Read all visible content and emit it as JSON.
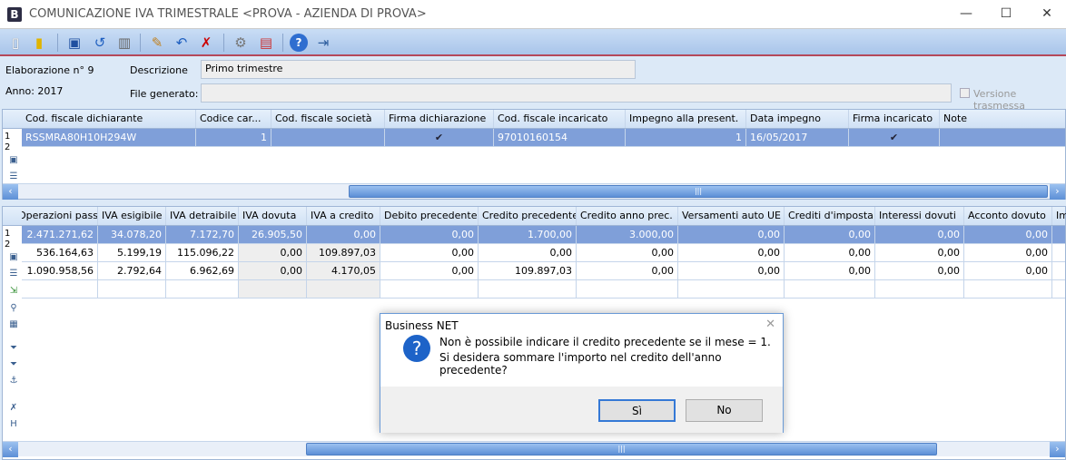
{
  "window": {
    "logo": "B",
    "title": "COMUNICAZIONE IVA TRIMESTRALE <PROVA - AZIENDA DI PROVA>",
    "minimize": "—",
    "maximize": "☐",
    "close": "✕"
  },
  "toolbar": [
    "new-icon",
    "open-icon",
    "save-icon",
    "undo-icon",
    "delete-icon",
    "edit-icon",
    "edit-undo-icon",
    "edit-cancel-icon",
    "settings-icon",
    "pdf-icon",
    "help-icon",
    "exit-icon"
  ],
  "header": {
    "elaborazione": "Elaborazione n° 9",
    "anno": "Anno: 2017",
    "descrizione_label": "Descrizione",
    "descrizione_value": "Primo trimestre",
    "file_label": "File generato:",
    "file_value": "",
    "versione_label": "Versione trasmessa"
  },
  "top_grid": {
    "columns": [
      "Cod. fiscale dichiarante",
      "Codice car...",
      "Cod. fiscale società",
      "Firma dichiarazione",
      "Cod. fiscale incaricato",
      "Impegno alla present.",
      "Data impegno",
      "Firma incaricato",
      "Note"
    ],
    "row_numbers": [
      "1",
      "2"
    ],
    "rows": [
      [
        "RSSMRA80H10H294W",
        "1",
        "",
        "✔",
        "97010160154",
        "1",
        "16/05/2017",
        "✔",
        ""
      ]
    ]
  },
  "bottom_grid": {
    "columns": [
      "Operazioni pass.",
      "IVA esigibile",
      "IVA detraibile",
      "IVA dovuta",
      "IVA a credito",
      "Debito precedente",
      "Credito precedente",
      "Credito anno prec.",
      "Versamenti auto UE",
      "Crediti d'imposta",
      "Interessi dovuti",
      "Acconto dovuto",
      "Im"
    ],
    "row_numbers": [
      "1",
      "2"
    ],
    "rows": [
      [
        "2.471.271,62",
        "34.078,20",
        "7.172,70",
        "26.905,50",
        "0,00",
        "0,00",
        "1.700,00",
        "3.000,00",
        "0,00",
        "0,00",
        "0,00",
        "0,00",
        ""
      ],
      [
        "536.164,63",
        "5.199,19",
        "115.096,22",
        "0,00",
        "109.897,03",
        "0,00",
        "0,00",
        "0,00",
        "0,00",
        "0,00",
        "0,00",
        "0,00",
        ""
      ],
      [
        "1.090.958,56",
        "2.792,64",
        "6.962,69",
        "0,00",
        "4.170,05",
        "0,00",
        "109.897,03",
        "0,00",
        "0,00",
        "0,00",
        "0,00",
        "0,00",
        ""
      ]
    ]
  },
  "dialog": {
    "title": "Business NET",
    "line1": "Non è possibile indicare il credito precedente se il mese = 1.",
    "line2": "Si desidera sommare l'importo nel credito dell'anno precedente?",
    "yes": "Sì",
    "no": "No",
    "close": "✕",
    "icon": "?"
  }
}
